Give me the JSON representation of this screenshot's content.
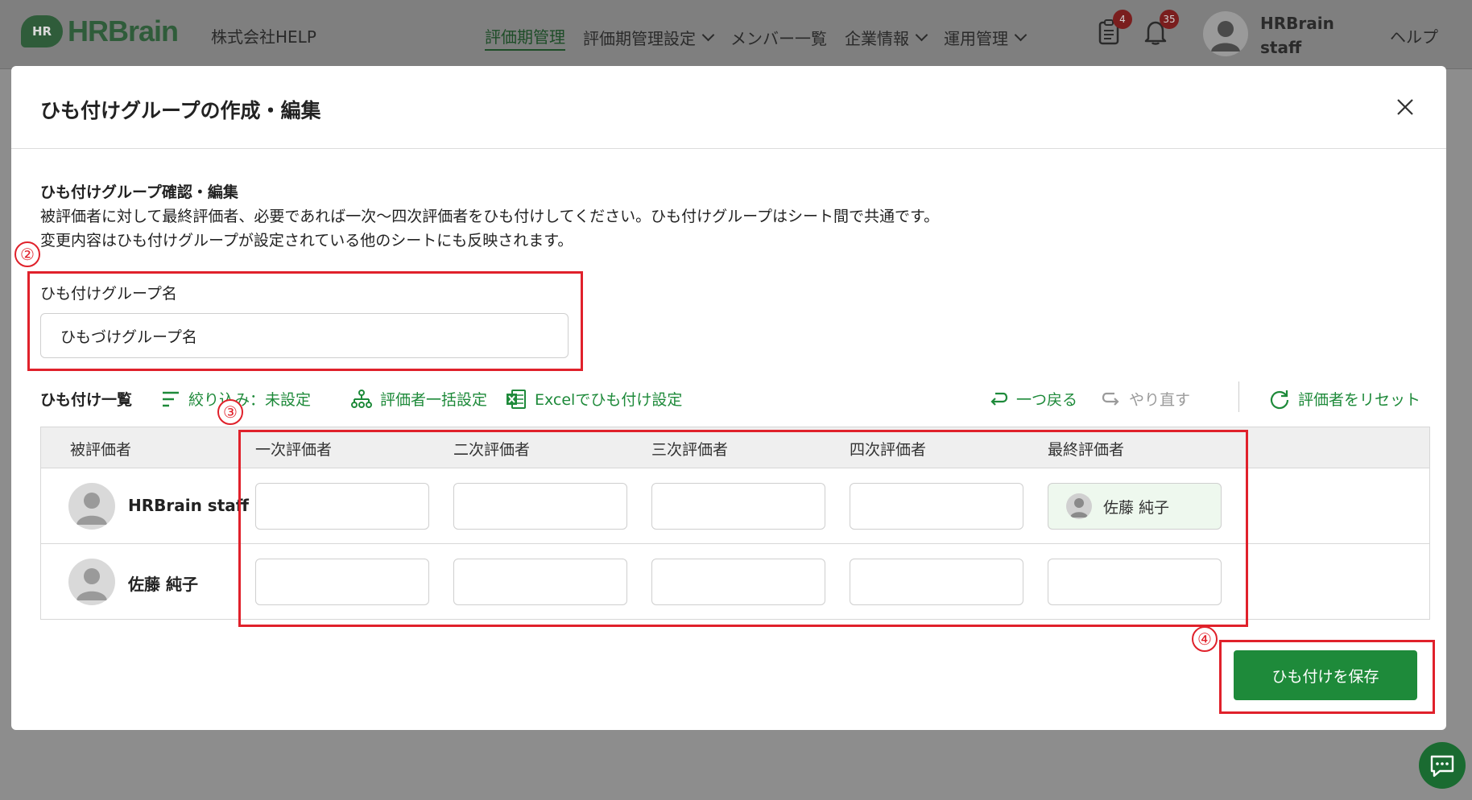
{
  "header": {
    "logo_badge": "HR",
    "logo_text": "HRBrain",
    "company": "株式会社HELP",
    "nav": [
      {
        "label": "評価期管理"
      },
      {
        "label": "評価期管理設定"
      },
      {
        "label": "メンバー一覧"
      },
      {
        "label": "企業情報"
      },
      {
        "label": "運用管理"
      }
    ],
    "tasks_badge": "4",
    "notifications_badge": "35",
    "user_name_line1": "HRBrain",
    "user_name_line2": "staff",
    "help": "ヘルプ"
  },
  "modal": {
    "title": "ひも付けグループの作成・編集",
    "section_title": "ひも付けグループ確認・編集",
    "description_1": "被評価者に対して最終評価者、必要であれば一次〜四次評価者をひも付けしてください。ひも付けグループはシート間で共通です。",
    "description_2": "変更内容はひも付けグループが設定されている他のシートにも反映されます。",
    "group_name_label": "ひも付けグループ名",
    "group_name_value": "ひもづけグループ名",
    "annotations": {
      "a2": "②",
      "a3": "③",
      "a4": "④"
    },
    "toolbar": {
      "label": "ひも付け一覧",
      "filter": "絞り込み：未設定",
      "bulk_set": "評価者一括設定",
      "excel": "Excelでひも付け設定",
      "undo": "一つ戻る",
      "redo": "やり直す",
      "reset": "評価者をリセット"
    },
    "table": {
      "headers": [
        "被評価者",
        "一次評価者",
        "二次評価者",
        "三次評価者",
        "四次評価者",
        "最終評価者"
      ],
      "rows": [
        {
          "name": "HRBrain staff",
          "final": "佐藤 純子"
        },
        {
          "name": "佐藤 純子",
          "final": ""
        }
      ]
    },
    "save_button": "ひも付けを保存"
  },
  "colors": {
    "accent_green": "#1e8a3a",
    "annotation_red": "#e0212b"
  }
}
